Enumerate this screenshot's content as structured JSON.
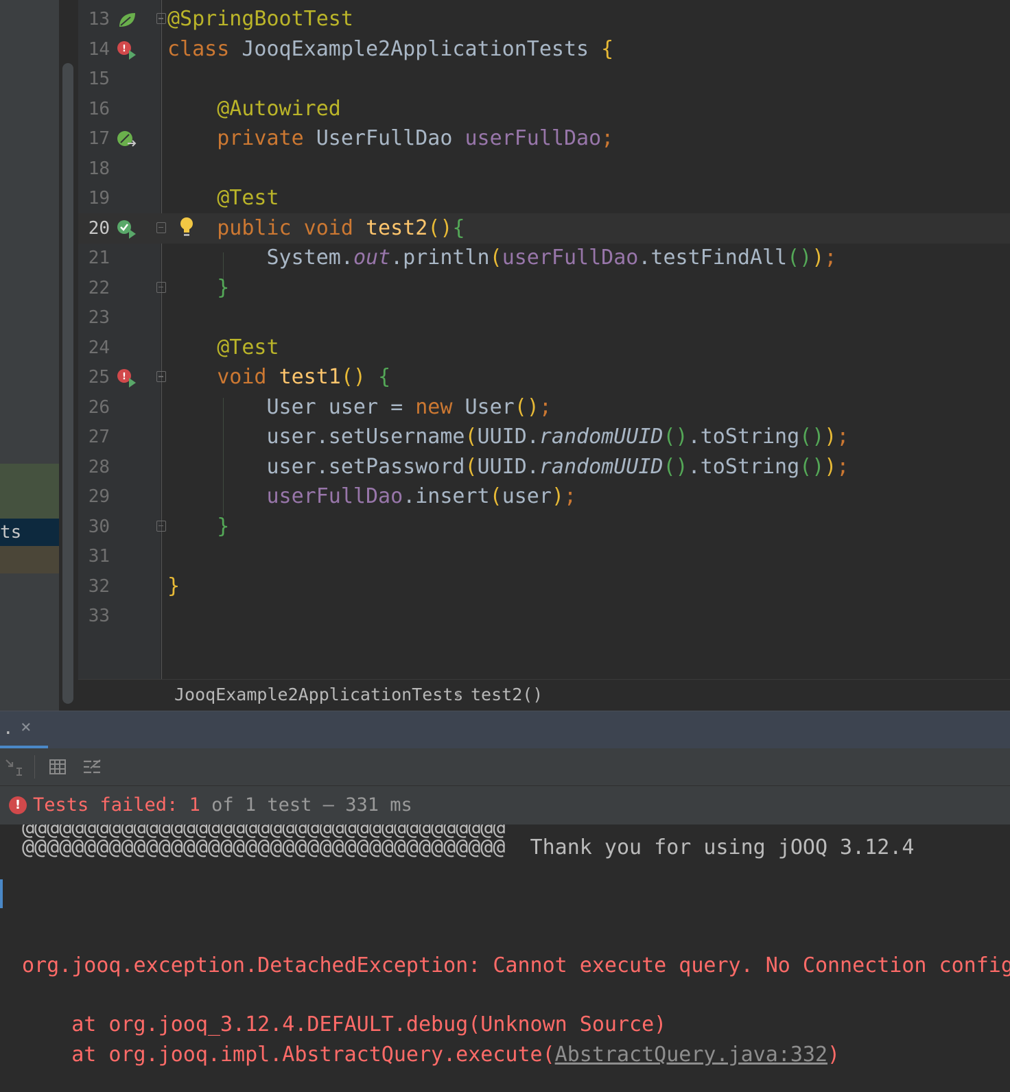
{
  "project_panel": {
    "selected_label_fragment": "ts"
  },
  "editor": {
    "lines": [
      {
        "num": "13",
        "icon": "spring-bean-icon",
        "fold": true,
        "current": false,
        "tokens": [
          [
            "ann",
            "@SpringBootTest"
          ]
        ]
      },
      {
        "num": "14",
        "icon": "run-test-failed-icon",
        "fold": false,
        "current": false,
        "tokens": [
          [
            "kw",
            "class "
          ],
          [
            "plain",
            "JooqExample2ApplicationTests "
          ],
          [
            "b1",
            "{"
          ]
        ]
      },
      {
        "num": "15",
        "icon": "",
        "fold": false,
        "current": false,
        "tokens": []
      },
      {
        "num": "16",
        "icon": "",
        "fold": false,
        "current": false,
        "tokens": [
          [
            "plain",
            "    "
          ],
          [
            "ann",
            "@Autowired"
          ]
        ]
      },
      {
        "num": "17",
        "icon": "autowired-bean-icon",
        "fold": false,
        "current": false,
        "tokens": [
          [
            "plain",
            "    "
          ],
          [
            "kw",
            "private "
          ],
          [
            "plain",
            "UserFullDao "
          ],
          [
            "fld",
            "userFullDao"
          ],
          [
            "semi",
            ";"
          ]
        ]
      },
      {
        "num": "18",
        "icon": "",
        "fold": false,
        "current": false,
        "tokens": []
      },
      {
        "num": "19",
        "icon": "",
        "fold": false,
        "current": false,
        "tokens": [
          [
            "plain",
            "    "
          ],
          [
            "ann",
            "@Test"
          ]
        ]
      },
      {
        "num": "20",
        "icon": "run-test-passed-icon",
        "fold": true,
        "current": true,
        "bulb": true,
        "tokens": [
          [
            "plain",
            "    "
          ],
          [
            "kw",
            "public void "
          ],
          [
            "mth",
            "test2"
          ],
          [
            "b1",
            "()"
          ],
          [
            "b2",
            "{"
          ]
        ]
      },
      {
        "num": "21",
        "icon": "",
        "fold": false,
        "current": false,
        "tokens": [
          [
            "plain",
            "        System."
          ],
          [
            "sta",
            "out"
          ],
          [
            "plain",
            ".println"
          ],
          [
            "b1",
            "("
          ],
          [
            "fld",
            "userFullDao"
          ],
          [
            "plain",
            ".testFindAll"
          ],
          [
            "b2",
            "()"
          ],
          [
            "b1",
            ")"
          ],
          [
            "semi",
            ";"
          ]
        ]
      },
      {
        "num": "22",
        "icon": "",
        "fold": true,
        "current": false,
        "tokens": [
          [
            "plain",
            "    "
          ],
          [
            "b2",
            "}"
          ]
        ]
      },
      {
        "num": "23",
        "icon": "",
        "fold": false,
        "current": false,
        "tokens": []
      },
      {
        "num": "24",
        "icon": "",
        "fold": false,
        "current": false,
        "tokens": [
          [
            "plain",
            "    "
          ],
          [
            "ann",
            "@Test"
          ]
        ]
      },
      {
        "num": "25",
        "icon": "run-test-failed-icon",
        "fold": true,
        "current": false,
        "tokens": [
          [
            "plain",
            "    "
          ],
          [
            "kw",
            "void "
          ],
          [
            "mth",
            "test1"
          ],
          [
            "b1",
            "() "
          ],
          [
            "b2",
            "{"
          ]
        ]
      },
      {
        "num": "26",
        "icon": "",
        "fold": false,
        "current": false,
        "tokens": [
          [
            "plain",
            "        User user = "
          ],
          [
            "kw",
            "new "
          ],
          [
            "plain",
            "User"
          ],
          [
            "b1",
            "()"
          ],
          [
            "semi",
            ";"
          ]
        ]
      },
      {
        "num": "27",
        "icon": "",
        "fold": false,
        "current": false,
        "tokens": [
          [
            "plain",
            "        user.setUsername"
          ],
          [
            "b1",
            "("
          ],
          [
            "plain",
            "UUID."
          ],
          [
            "ita",
            "randomUUID"
          ],
          [
            "b2",
            "()"
          ],
          [
            "plain",
            ".toString"
          ],
          [
            "b2",
            "()"
          ],
          [
            "b1",
            ")"
          ],
          [
            "semi",
            ";"
          ]
        ]
      },
      {
        "num": "28",
        "icon": "",
        "fold": false,
        "current": false,
        "tokens": [
          [
            "plain",
            "        user.setPassword"
          ],
          [
            "b1",
            "("
          ],
          [
            "plain",
            "UUID."
          ],
          [
            "ita",
            "randomUUID"
          ],
          [
            "b2",
            "()"
          ],
          [
            "plain",
            ".toString"
          ],
          [
            "b2",
            "()"
          ],
          [
            "b1",
            ")"
          ],
          [
            "semi",
            ";"
          ]
        ]
      },
      {
        "num": "29",
        "icon": "",
        "fold": false,
        "current": false,
        "tokens": [
          [
            "plain",
            "        "
          ],
          [
            "fld",
            "userFullDao"
          ],
          [
            "plain",
            ".insert"
          ],
          [
            "b1",
            "("
          ],
          [
            "plain",
            "user"
          ],
          [
            "b1",
            ")"
          ],
          [
            "semi",
            ";"
          ]
        ]
      },
      {
        "num": "30",
        "icon": "",
        "fold": true,
        "current": false,
        "tokens": [
          [
            "plain",
            "    "
          ],
          [
            "b2",
            "}"
          ]
        ]
      },
      {
        "num": "31",
        "icon": "",
        "fold": false,
        "current": false,
        "tokens": []
      },
      {
        "num": "32",
        "icon": "",
        "fold": false,
        "current": false,
        "tokens": [
          [
            "b1",
            "}"
          ]
        ]
      },
      {
        "num": "33",
        "icon": "",
        "fold": false,
        "current": false,
        "tokens": []
      }
    ]
  },
  "breadcrumb": {
    "class_name": "JooqExample2ApplicationTests",
    "separator": "›",
    "method_name": "test2()"
  },
  "tool_window": {
    "tab_label": ".",
    "close_glyph": "×",
    "toolbar_icons": [
      "sort-icon",
      "table-icon",
      "filter-icon"
    ],
    "status": {
      "prefix": "Tests failed: ",
      "failed": "1",
      "of": " of ",
      "total": "1 test",
      "sep": " – ",
      "time": "331 ms"
    }
  },
  "console": {
    "lines": [
      {
        "text": "@@@@@@@@@@@@@@@@@@@@@@@@@@@@@@@@@@@@@@@",
        "cls": "c-gray"
      },
      {
        "text": "@@@@@@@@@@@@@@@@@@@@@@@@@@@@@@@@@@@@@@@  Thank you for using jOOQ 3.12.4",
        "cls": "c-gray"
      },
      {
        "text": "org.jooq.exception.DetachedException: Cannot execute query. No Connection config",
        "cls": "c-red"
      },
      {
        "text": "    at org.jooq_3.12.4.DEFAULT.debug(Unknown Source)",
        "cls": "c-red"
      },
      {
        "text": "    at org.jooq.impl.AbstractQuery.execute(",
        "cls": "c-red",
        "link": "AbstractQuery.java:332",
        "tail": ")"
      }
    ]
  }
}
